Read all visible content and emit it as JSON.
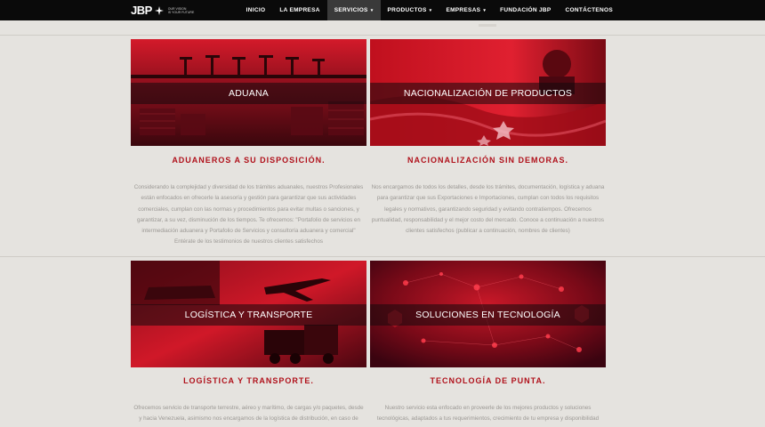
{
  "brand": {
    "logo": "JBP",
    "tagline_line1": "OUR VISION",
    "tagline_line2": "IS YOUR FUTURE"
  },
  "nav": {
    "items": [
      {
        "label": "INICIO"
      },
      {
        "label": "LA EMPRESA"
      },
      {
        "label": "SERVICIOS",
        "caret": "▾"
      },
      {
        "label": "PRODUCTOS",
        "caret": "▾"
      },
      {
        "label": "EMPRESAS",
        "caret": "▾"
      },
      {
        "label": "FUNDACIÓN JBP"
      },
      {
        "label": "CONTÁCTENOS"
      }
    ],
    "active": "SERVICIOS"
  },
  "services": [
    {
      "image_label": "ADUANA",
      "heading": "ADUANEROS A SU DISPOSICIÓN.",
      "lines": [
        "Considerando la complejidad y diversidad de los trámites aduanales, nuestros Profesionales",
        "están enfocados en ofrecerle la asesoría y gestión para garantizar que sus actividades",
        "comerciales, cumplan con las normas y procedimientos para evitar multas o sanciones, y",
        "garantizar, a su vez, disminución de los tiempos. Te ofrecemos: \"Portafolio de servicios en",
        "intermediación aduanera y Portafolio de Servicios y consultoría aduanera y comercial\"",
        "Entérate de los testimonios de nuestros clientes satisfechos"
      ]
    },
    {
      "image_label": "NACIONALIZACIÓN DE PRODUCTOS",
      "heading": "NACIONALIZACIÓN SIN DEMORAS.",
      "lines": [
        "Nos encargamos de todos los detalles, desde los trámites, documentación, logística y aduana",
        "para garantizar que sus Exportaciones e Importaciones, cumplan con todos los requisitos",
        "legales y normativos, garantizando seguridad y evitando contratiempos. Ofrecemos",
        "puntualidad, responsabilidad y el mejor costo del mercado. Conoce a continuación a nuestros",
        "clientes satisfechos (publicar a continuación, nombres de clientes)"
      ]
    },
    {
      "image_label": "LOGÍSTICA Y TRANSPORTE",
      "heading": "LOGÍSTICA Y TRANSPORTE.",
      "lines": [
        "Ofrecemos servicio de transporte terrestre, aéreo y marítimo, de cargas y/o paquetes, desde",
        "y hacia Venezuela, asimismo nos encargamos de la logística de distribución, en caso de"
      ]
    },
    {
      "image_label": "SOLUCIONES EN TECNOLOGÍA",
      "heading": "TECNOLOGÍA DE PUNTA.",
      "lines": [
        "Nuestro servicio esta enfocado en proveerle de los mejores productos y soluciones",
        "tecnológicas, adaptados a tus requerimientos, crecimiento de tu empresa y disponibilidad"
      ]
    }
  ],
  "colors": {
    "accent": "#b0101a",
    "nav_bg": "#0a0a0a",
    "page_bg": "#e5e3df"
  }
}
